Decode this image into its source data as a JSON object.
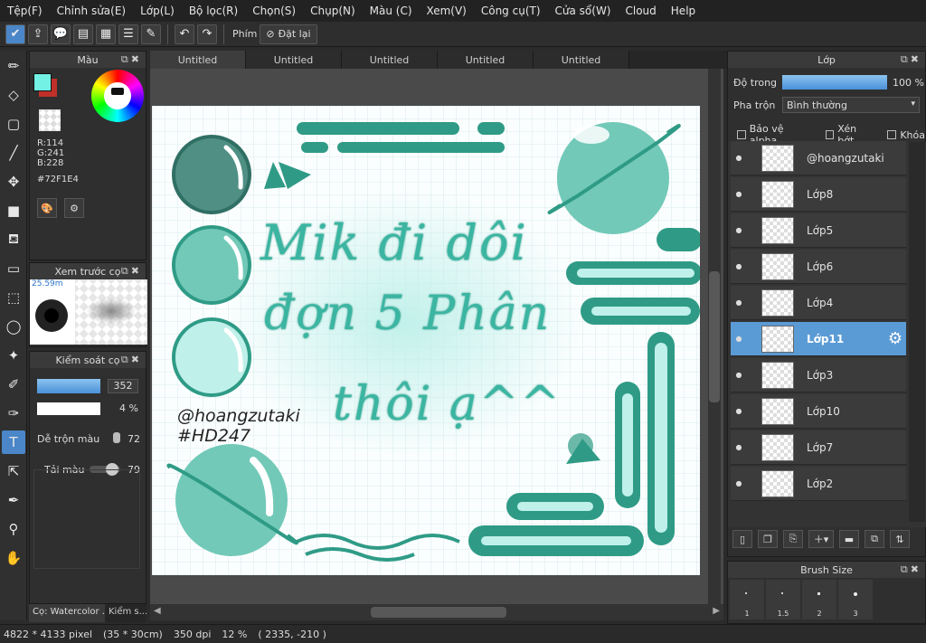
{
  "menu": [
    "Tệp(F)",
    "Chỉnh sửa(E)",
    "Lớp(L)",
    "Bộ lọc(R)",
    "Chọn(S)",
    "Chụp(N)",
    "Màu (C)",
    "Xem(V)",
    "Công cụ(T)",
    "Cửa sổ(W)",
    "Cloud",
    "Help"
  ],
  "toolbar": {
    "keyboard_label": "Phím",
    "reset_label": "Đặt lại"
  },
  "color_panel": {
    "title": "Màu",
    "r": "R:114",
    "g": "G:241",
    "b": "B:228",
    "hex": "#72F1E4",
    "fg_color": "#72F1E4",
    "bg_color": "#c0302a"
  },
  "brush_preview": {
    "title": "Xem trước cọ",
    "size_text": "25.59m"
  },
  "brush_control": {
    "title": "Kiểm soát cọ",
    "size_value": "352",
    "opacity_value": "4 %",
    "blend_label": "Dễ trộn màu",
    "blend_value": "72",
    "load_label": "Tải màu",
    "load_value": "79"
  },
  "left_tabs": [
    "Cọ: Watercolor ...",
    "Kiểm s..."
  ],
  "tabs": [
    "Untitled",
    "Untitled",
    "Untitled",
    "Untitled",
    "Untitled"
  ],
  "canvas": {
    "line1": "Mik đi dôi",
    "line2": "đợn 5 Phân",
    "line3": "thôi ạ^^",
    "handle": "@hoangzutaki",
    "tag": "#HD247",
    "primary_color": "#2f9b86",
    "light_color": "#bff0ea"
  },
  "layer_panel": {
    "title": "Lớp",
    "opacity_label": "Độ trong",
    "opacity_value": "100 %",
    "blend_label": "Pha trộn",
    "blend_value": "Bình thường",
    "protect_alpha": "Bảo vệ alpha",
    "clipping": "Xén bớt",
    "lock": "Khóa",
    "layers": [
      "@hoangzutaki",
      "Lớp8",
      "Lớp5",
      "Lớp6",
      "Lớp4",
      "Lớp11",
      "Lớp3",
      "Lớp10",
      "Lớp7",
      "Lớp2"
    ],
    "selected_layer": "Lớp11"
  },
  "brush_size": {
    "title": "Brush Size",
    "sizes": [
      "1",
      "1.5",
      "2",
      "3"
    ]
  },
  "status": {
    "pixels": "4822 * 4133 pixel",
    "cm": "(35 * 30cm)",
    "dpi": "350 dpi",
    "zoom": "12 %",
    "coords": "( 2335, -210 )"
  }
}
